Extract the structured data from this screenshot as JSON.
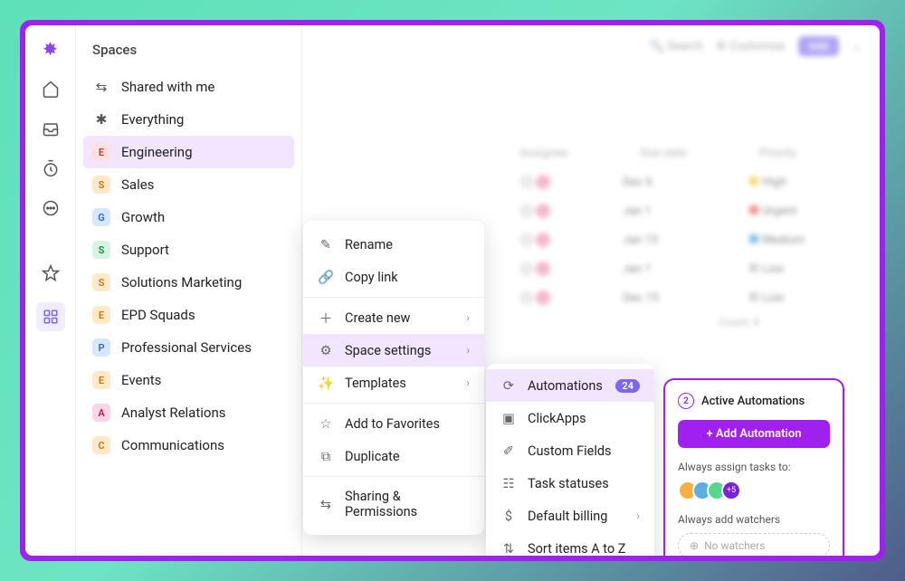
{
  "sidebar": {
    "title": "Spaces",
    "top_items": [
      {
        "label": "Shared with me",
        "icon": "share"
      },
      {
        "label": "Everything",
        "icon": "network"
      }
    ],
    "spaces": [
      {
        "letter": "E",
        "label": "Engineering",
        "bg": "#ffe0e0",
        "fg": "#c0392b",
        "selected": true
      },
      {
        "letter": "S",
        "label": "Sales",
        "bg": "#ffe9c8",
        "fg": "#b9770e"
      },
      {
        "letter": "G",
        "label": "Growth",
        "bg": "#d6e8ff",
        "fg": "#2e66c4"
      },
      {
        "letter": "S",
        "label": "Support",
        "bg": "#d4f5e2",
        "fg": "#1e8449"
      },
      {
        "letter": "S",
        "label": "Solutions Marketing",
        "bg": "#ffe9c8",
        "fg": "#b9770e"
      },
      {
        "letter": "E",
        "label": "EPD Squads",
        "bg": "#ffe9c8",
        "fg": "#b9770e"
      },
      {
        "letter": "P",
        "label": "Professional Services",
        "bg": "#d6e8ff",
        "fg": "#2e66c4"
      },
      {
        "letter": "E",
        "label": "Events",
        "bg": "#ffe9c8",
        "fg": "#b9770e"
      },
      {
        "letter": "A",
        "label": "Analyst Relations",
        "bg": "#ffd6e7",
        "fg": "#c2185b"
      },
      {
        "letter": "C",
        "label": "Communications",
        "bg": "#ffe9c8",
        "fg": "#b9770e"
      }
    ]
  },
  "topbar": {
    "search": "Search",
    "customize": "Customize",
    "add": "Add"
  },
  "columns": {
    "assignee": "Assignee",
    "due": "Due date",
    "priority": "Priority"
  },
  "rows": [
    {
      "due": "Dec 6",
      "pri": "High",
      "pcolor": "#f1c40f"
    },
    {
      "due": "Jan 1",
      "pri": "Urgent",
      "pcolor": "#e74c3c"
    },
    {
      "due": "Jan 15",
      "pri": "Medium",
      "pcolor": "#3498db"
    },
    {
      "due": "Jan 1",
      "pri": "Low",
      "pcolor": "#bbb"
    },
    {
      "due": "Dec 15",
      "pri": "Low",
      "pcolor": "#bbb"
    }
  ],
  "count_label": "Count: 4",
  "ctx1": {
    "rename": "Rename",
    "copy": "Copy link",
    "create": "Create new",
    "settings": "Space settings",
    "templates": "Templates",
    "favorites": "Add to Favorites",
    "duplicate": "Duplicate",
    "sharing": "Sharing & Permissions"
  },
  "ctx2": {
    "automations": "Automations",
    "auto_count": "24",
    "clickapps": "ClickApps",
    "custom": "Custom Fields",
    "statuses": "Task statuses",
    "billing": "Default billing",
    "sort": "Sort items A to Z"
  },
  "panel": {
    "count": "2",
    "title": "Active Automations",
    "add_btn": "+  Add Automation",
    "assign_label": "Always assign tasks to:",
    "more": "+5",
    "watchers_label": "Always add watchers",
    "no_watchers": "No watchers"
  }
}
